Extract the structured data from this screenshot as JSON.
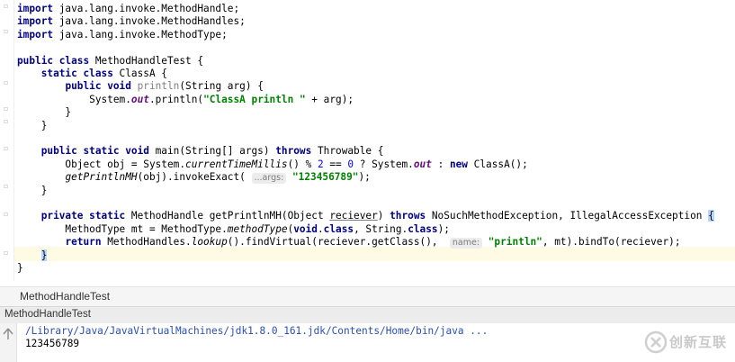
{
  "editor": {
    "lines": [
      {
        "parts": [
          {
            "t": "import",
            "c": "kw"
          },
          {
            "t": " java.lang.invoke.MethodHandle;"
          }
        ]
      },
      {
        "parts": [
          {
            "t": "import",
            "c": "kw"
          },
          {
            "t": " java.lang.invoke.MethodHandles;"
          }
        ]
      },
      {
        "parts": [
          {
            "t": "import",
            "c": "kw"
          },
          {
            "t": " java.lang.invoke.MethodType;"
          }
        ]
      },
      {
        "parts": []
      },
      {
        "parts": [
          {
            "t": "public class",
            "c": "kw"
          },
          {
            "t": " MethodHandleTest {"
          }
        ]
      },
      {
        "parts": [
          {
            "t": "    "
          },
          {
            "t": "static class",
            "c": "kw"
          },
          {
            "t": " ClassA {"
          }
        ]
      },
      {
        "parts": [
          {
            "t": "        "
          },
          {
            "t": "public void",
            "c": "kw"
          },
          {
            "t": " "
          },
          {
            "t": "println",
            "c": "unused"
          },
          {
            "t": "(String arg) {"
          }
        ]
      },
      {
        "parts": [
          {
            "t": "            System."
          },
          {
            "t": "out",
            "c": "fld"
          },
          {
            "t": ".println("
          },
          {
            "t": "\"ClassA println \"",
            "c": "str"
          },
          {
            "t": " + arg);"
          }
        ]
      },
      {
        "parts": [
          {
            "t": "        }"
          }
        ]
      },
      {
        "parts": [
          {
            "t": "    }"
          }
        ]
      },
      {
        "parts": []
      },
      {
        "parts": [
          {
            "t": "    "
          },
          {
            "t": "public static void",
            "c": "kw"
          },
          {
            "t": " main(String[] args) "
          },
          {
            "t": "throws",
            "c": "kw"
          },
          {
            "t": " Throwable {"
          }
        ]
      },
      {
        "parts": [
          {
            "t": "        Object obj = System."
          },
          {
            "t": "currentTimeMillis",
            "c": "ital"
          },
          {
            "t": "() % "
          },
          {
            "t": "2",
            "c": "num"
          },
          {
            "t": " == "
          },
          {
            "t": "0",
            "c": "num"
          },
          {
            "t": " ? System."
          },
          {
            "t": "out",
            "c": "fld"
          },
          {
            "t": " : "
          },
          {
            "t": "new",
            "c": "kw"
          },
          {
            "t": " ClassA();"
          }
        ]
      },
      {
        "parts": [
          {
            "t": "        "
          },
          {
            "t": "getPrintlnMH",
            "c": "ital"
          },
          {
            "t": "(obj).invokeExact( "
          },
          {
            "t": "...args:",
            "c": "hint"
          },
          {
            "t": " "
          },
          {
            "t": "\"123456789\"",
            "c": "str"
          },
          {
            "t": ");"
          }
        ]
      },
      {
        "parts": [
          {
            "t": "    }"
          }
        ]
      },
      {
        "parts": []
      },
      {
        "parts": [
          {
            "t": "    "
          },
          {
            "t": "private static",
            "c": "kw"
          },
          {
            "t": " MethodHandle getPrintlnMH(Object "
          },
          {
            "t": "reciever",
            "c": "under"
          },
          {
            "t": ") "
          },
          {
            "t": "throws",
            "c": "kw"
          },
          {
            "t": " NoSuchMethodException, IllegalAccessException "
          },
          {
            "t": "{",
            "c": "bracehl"
          }
        ]
      },
      {
        "parts": [
          {
            "t": "        MethodType mt = MethodType."
          },
          {
            "t": "methodType",
            "c": "ital"
          },
          {
            "t": "("
          },
          {
            "t": "void",
            "c": "kw"
          },
          {
            "t": "."
          },
          {
            "t": "class",
            "c": "kw"
          },
          {
            "t": ", String."
          },
          {
            "t": "class",
            "c": "kw"
          },
          {
            "t": ");"
          }
        ]
      },
      {
        "parts": [
          {
            "t": "        "
          },
          {
            "t": "return",
            "c": "kw"
          },
          {
            "t": " MethodHandles."
          },
          {
            "t": "lookup",
            "c": "ital"
          },
          {
            "t": "().findVirtual(reciever.getClass(),  "
          },
          {
            "t": "name:",
            "c": "hint"
          },
          {
            "t": " "
          },
          {
            "t": "\"println\"",
            "c": "str"
          },
          {
            "t": ", mt).bindTo(reciever);"
          }
        ]
      },
      {
        "parts": [
          {
            "t": "    "
          },
          {
            "t": "}",
            "c": "bracehl"
          }
        ]
      },
      {
        "parts": [
          {
            "t": "}"
          }
        ]
      }
    ]
  },
  "breadcrumb": {
    "label": "MethodHandleTest"
  },
  "run_panel": {
    "title": "MethodHandleTest"
  },
  "console": {
    "command": "/Library/Java/JavaVirtualMachines/jdk1.8.0_161.jdk/Contents/Home/bin/java ...",
    "output": "123456789"
  },
  "watermark": {
    "text": "创新互联"
  }
}
